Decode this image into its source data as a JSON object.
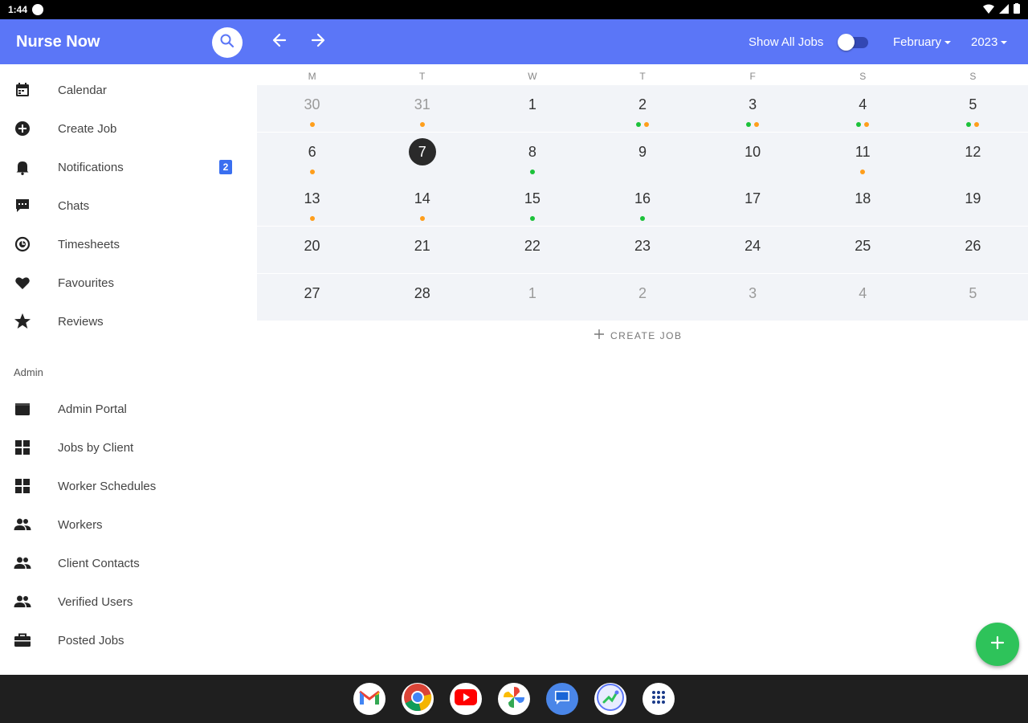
{
  "status_bar": {
    "time": "1:44"
  },
  "app": {
    "title": "Nurse Now",
    "show_all_jobs_label": "Show All Jobs",
    "show_all_jobs_on": false,
    "month": "February",
    "year": "2023",
    "accent_color": "#5b76f7"
  },
  "sidebar": {
    "items": [
      {
        "label": "Calendar",
        "icon": "calendar-icon"
      },
      {
        "label": "Create Job",
        "icon": "add-circle-icon"
      },
      {
        "label": "Notifications",
        "icon": "bell-icon",
        "badge": "2"
      },
      {
        "label": "Chats",
        "icon": "chat-icon"
      },
      {
        "label": "Timesheets",
        "icon": "clock-icon"
      },
      {
        "label": "Favourites",
        "icon": "heart-icon"
      },
      {
        "label": "Reviews",
        "icon": "star-icon"
      }
    ],
    "admin_header": "Admin",
    "admin_items": [
      {
        "label": "Admin Portal",
        "icon": "portal-icon"
      },
      {
        "label": "Jobs by Client",
        "icon": "grid-icon"
      },
      {
        "label": "Worker Schedules",
        "icon": "grid-icon"
      },
      {
        "label": "Workers",
        "icon": "people-icon"
      },
      {
        "label": "Client Contacts",
        "icon": "people-icon"
      },
      {
        "label": "Verified Users",
        "icon": "people-icon"
      },
      {
        "label": "Posted Jobs",
        "icon": "briefcase-icon"
      }
    ]
  },
  "calendar": {
    "weekdays": [
      "M",
      "T",
      "W",
      "T",
      "F",
      "S",
      "S"
    ],
    "weeks": [
      [
        {
          "day": "30",
          "other": true,
          "dots": [
            "orange"
          ]
        },
        {
          "day": "31",
          "other": true,
          "dots": [
            "orange"
          ]
        },
        {
          "day": "1",
          "dots": []
        },
        {
          "day": "2",
          "dots": [
            "green",
            "orange"
          ]
        },
        {
          "day": "3",
          "dots": [
            "green",
            "orange"
          ]
        },
        {
          "day": "4",
          "dots": [
            "green",
            "orange"
          ]
        },
        {
          "day": "5",
          "dots": [
            "green",
            "orange"
          ]
        }
      ],
      [
        {
          "day": "6",
          "dots": [
            "orange"
          ]
        },
        {
          "day": "7",
          "today": true,
          "dots": []
        },
        {
          "day": "8",
          "dots": [
            "green"
          ]
        },
        {
          "day": "9",
          "dots": []
        },
        {
          "day": "10",
          "dots": []
        },
        {
          "day": "11",
          "dots": [
            "orange"
          ]
        },
        {
          "day": "12",
          "dots": []
        }
      ],
      [
        {
          "day": "13",
          "dots": [
            "orange"
          ]
        },
        {
          "day": "14",
          "dots": [
            "orange"
          ]
        },
        {
          "day": "15",
          "dots": [
            "green"
          ]
        },
        {
          "day": "16",
          "dots": [
            "green"
          ]
        },
        {
          "day": "17",
          "dots": []
        },
        {
          "day": "18",
          "dots": []
        },
        {
          "day": "19",
          "dots": []
        }
      ],
      [
        {
          "day": "20",
          "dots": []
        },
        {
          "day": "21",
          "dots": []
        },
        {
          "day": "22",
          "dots": []
        },
        {
          "day": "23",
          "dots": []
        },
        {
          "day": "24",
          "dots": []
        },
        {
          "day": "25",
          "dots": []
        },
        {
          "day": "26",
          "dots": []
        }
      ],
      [
        {
          "day": "27",
          "dots": []
        },
        {
          "day": "28",
          "dots": []
        },
        {
          "day": "1",
          "other": true,
          "dots": []
        },
        {
          "day": "2",
          "other": true,
          "dots": []
        },
        {
          "day": "3",
          "other": true,
          "dots": []
        },
        {
          "day": "4",
          "other": true,
          "dots": []
        },
        {
          "day": "5",
          "other": true,
          "dots": []
        }
      ]
    ],
    "create_job_label": "CREATE JOB"
  },
  "dock": {
    "apps": [
      "gmail-icon",
      "chrome-icon",
      "youtube-icon",
      "photos-icon",
      "messages-icon",
      "nurse-now-icon",
      "app-drawer-icon"
    ]
  }
}
